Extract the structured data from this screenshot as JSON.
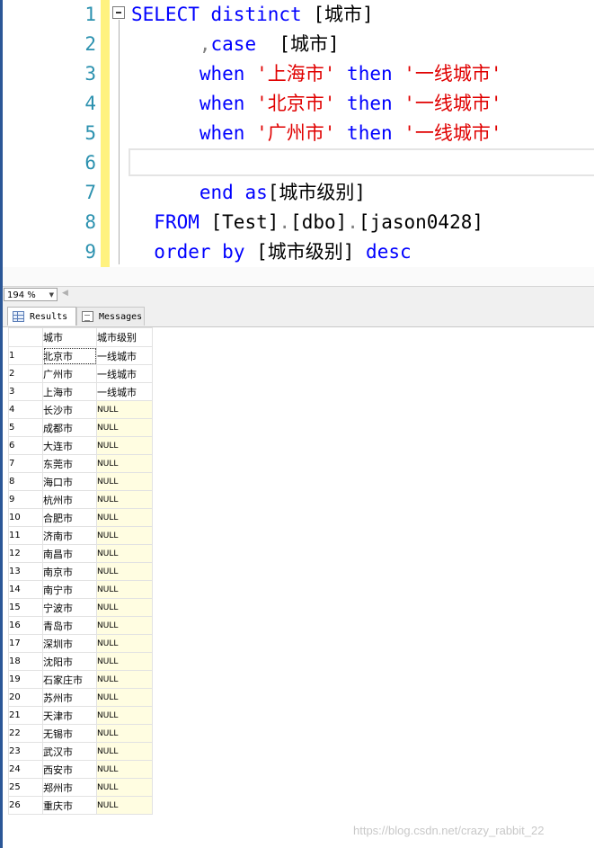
{
  "editor": {
    "line_numbers": [
      "1",
      "2",
      "3",
      "4",
      "5",
      "6",
      "7",
      "8",
      "9"
    ],
    "lines": [
      [
        {
          "t": "SELECT",
          "c": "kw"
        },
        {
          "t": " "
        },
        {
          "t": "distinct",
          "c": "kw"
        },
        {
          "t": " [城市]"
        }
      ],
      [
        {
          "t": "      "
        },
        {
          "t": ",",
          "c": "gray"
        },
        {
          "t": "case",
          "c": "kw"
        },
        {
          "t": "  [城市]"
        }
      ],
      [
        {
          "t": "      "
        },
        {
          "t": "when",
          "c": "kw"
        },
        {
          "t": " "
        },
        {
          "t": "'上海市'",
          "c": "str"
        },
        {
          "t": " "
        },
        {
          "t": "then",
          "c": "kw"
        },
        {
          "t": " "
        },
        {
          "t": "'一线城市'",
          "c": "str"
        }
      ],
      [
        {
          "t": "      "
        },
        {
          "t": "when",
          "c": "kw"
        },
        {
          "t": " "
        },
        {
          "t": "'北京市'",
          "c": "str"
        },
        {
          "t": " "
        },
        {
          "t": "then",
          "c": "kw"
        },
        {
          "t": " "
        },
        {
          "t": "'一线城市'",
          "c": "str"
        }
      ],
      [
        {
          "t": "      "
        },
        {
          "t": "when",
          "c": "kw"
        },
        {
          "t": " "
        },
        {
          "t": "'广州市'",
          "c": "str"
        },
        {
          "t": " "
        },
        {
          "t": "then",
          "c": "kw"
        },
        {
          "t": " "
        },
        {
          "t": "'一线城市'",
          "c": "str"
        }
      ],
      [
        {
          "t": ""
        }
      ],
      [
        {
          "t": "      "
        },
        {
          "t": "end",
          "c": "kw"
        },
        {
          "t": " "
        },
        {
          "t": "as",
          "c": "kw"
        },
        {
          "t": "[城市级别]"
        }
      ],
      [
        {
          "t": "  "
        },
        {
          "t": "FROM",
          "c": "kw"
        },
        {
          "t": " [Test]"
        },
        {
          "t": ".",
          "c": "gray"
        },
        {
          "t": "[dbo]"
        },
        {
          "t": ".",
          "c": "gray"
        },
        {
          "t": "[jason0428]"
        }
      ],
      [
        {
          "t": "  "
        },
        {
          "t": "order",
          "c": "kw"
        },
        {
          "t": " "
        },
        {
          "t": "by",
          "c": "kw"
        },
        {
          "t": " [城市级别] "
        },
        {
          "t": "desc",
          "c": "kw"
        }
      ]
    ]
  },
  "zoom": {
    "value": "194 %"
  },
  "tabs": {
    "results": "Results",
    "messages": "Messages"
  },
  "grid": {
    "columns": [
      "城市",
      "城市级别"
    ],
    "rows": [
      [
        "1",
        "北京市",
        "一线城市"
      ],
      [
        "2",
        "广州市",
        "一线城市"
      ],
      [
        "3",
        "上海市",
        "一线城市"
      ],
      [
        "4",
        "长沙市",
        "NULL"
      ],
      [
        "5",
        "成都市",
        "NULL"
      ],
      [
        "6",
        "大连市",
        "NULL"
      ],
      [
        "7",
        "东莞市",
        "NULL"
      ],
      [
        "8",
        "海口市",
        "NULL"
      ],
      [
        "9",
        "杭州市",
        "NULL"
      ],
      [
        "10",
        "合肥市",
        "NULL"
      ],
      [
        "11",
        "济南市",
        "NULL"
      ],
      [
        "12",
        "南昌市",
        "NULL"
      ],
      [
        "13",
        "南京市",
        "NULL"
      ],
      [
        "14",
        "南宁市",
        "NULL"
      ],
      [
        "15",
        "宁波市",
        "NULL"
      ],
      [
        "16",
        "青岛市",
        "NULL"
      ],
      [
        "17",
        "深圳市",
        "NULL"
      ],
      [
        "18",
        "沈阳市",
        "NULL"
      ],
      [
        "19",
        "石家庄市",
        "NULL"
      ],
      [
        "20",
        "苏州市",
        "NULL"
      ],
      [
        "21",
        "天津市",
        "NULL"
      ],
      [
        "22",
        "无锡市",
        "NULL"
      ],
      [
        "23",
        "武汉市",
        "NULL"
      ],
      [
        "24",
        "西安市",
        "NULL"
      ],
      [
        "25",
        "郑州市",
        "NULL"
      ],
      [
        "26",
        "重庆市",
        "NULL"
      ]
    ]
  },
  "watermark": "https://blog.csdn.net/crazy_rabbit_22"
}
